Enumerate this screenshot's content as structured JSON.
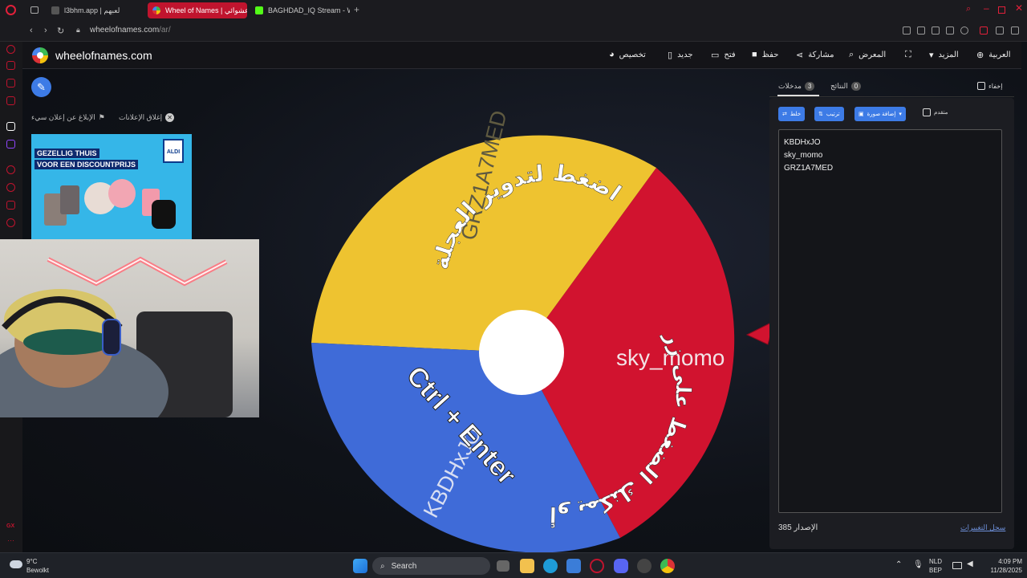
{
  "browser": {
    "tabs": [
      {
        "title": "l3bhm.app | لعبهم"
      },
      {
        "title": "Wheel of Names | عشوائي"
      },
      {
        "title": "BAGHDAD_IQ Stream - W"
      }
    ],
    "url_host": "wheelofnames.com",
    "url_path": "/ar/"
  },
  "site": {
    "name": "wheelofnames.com",
    "menu": {
      "customize": "تخصيص",
      "new": "جديد",
      "open": "فتح",
      "save": "حفظ",
      "share": "مشاركة",
      "gallery": "المعرض",
      "more": "المزيد",
      "language": "العربية"
    }
  },
  "ads": {
    "close_ads": "إغلاق الإعلانات",
    "report_ad": "الإبلاغ عن إعلان سيء",
    "line1": "GEZELLIG THUIS",
    "line2": "VOOR EEN DISCOUNTPRIJS",
    "brand": "ALDI"
  },
  "wheel": {
    "slices": [
      {
        "name": "GRZ1A7MED",
        "color": "#eec330"
      },
      {
        "name": "sky_momo",
        "color": "#d1132f"
      },
      {
        "name": "KBDHxJO",
        "color": "#3f6bd8"
      }
    ],
    "instruction_top": "اضغط لتدوير العجلة",
    "instruction_bottom": "أو يمكنك الضغط على زر",
    "shortcut": "Ctrl + Enter",
    "pointer_color": "#d1132f"
  },
  "panel": {
    "tab_entries": "مدخلات",
    "tab_entries_count": "3",
    "tab_results": "النتائج",
    "tab_results_count": "0",
    "hide_label": "إخفاء",
    "shuffle": "خلط",
    "sort": "ترتيب",
    "add_image": "إضافة صورة",
    "advanced": "متقدم",
    "entries": [
      "KBDHxJO",
      "sky_momo",
      "GRZ1A7MED"
    ],
    "version_label": "الإصدار",
    "version": "385",
    "changelog": "سجل التغييرات"
  },
  "taskbar": {
    "temp": "9°C",
    "weather": "Bewolkt",
    "search": "Search",
    "lang1": "NLD",
    "lang2": "BEP",
    "time": "4:09 PM",
    "date": "11/28/2025"
  }
}
